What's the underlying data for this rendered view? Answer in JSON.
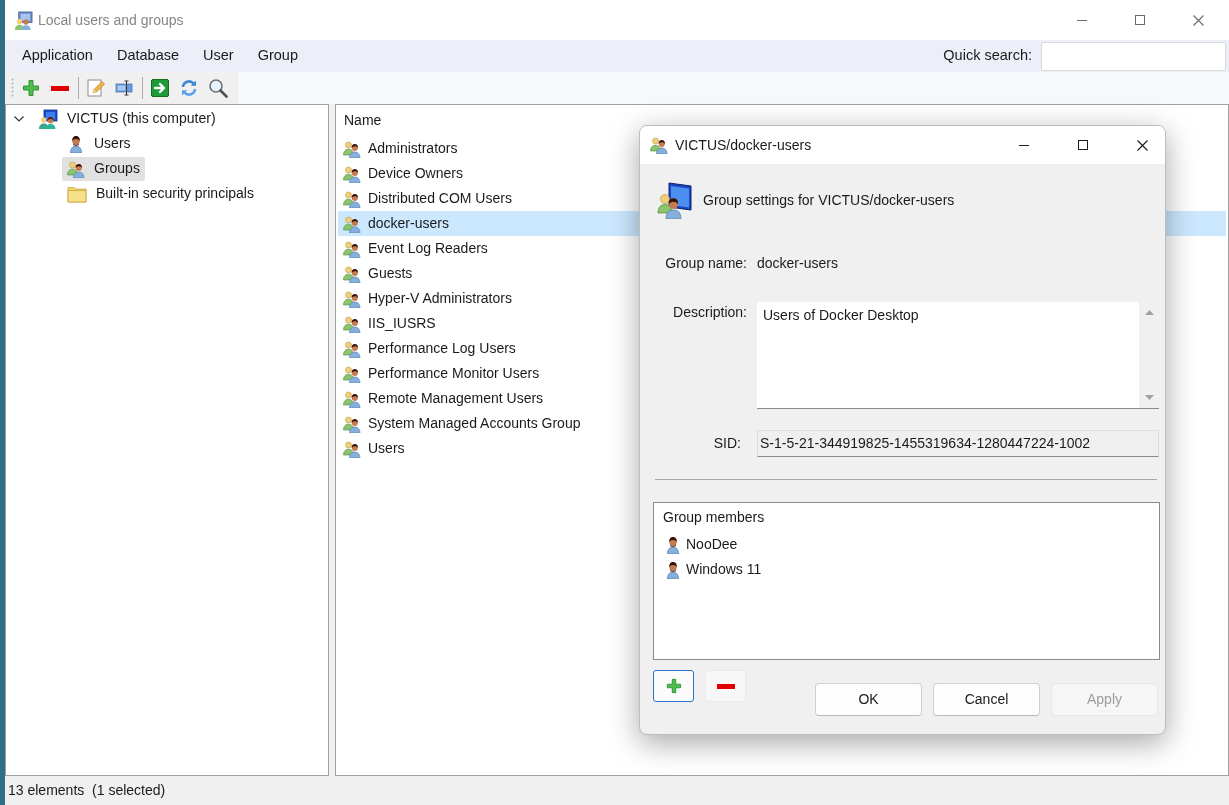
{
  "window": {
    "title": "Local users and groups",
    "active": false
  },
  "menu": [
    "Application",
    "Database",
    "User",
    "Group"
  ],
  "quick_search": {
    "label": "Quick search:"
  },
  "tree": [
    {
      "label": "VICTUS (this computer)",
      "kind": "computer",
      "expanded": true,
      "selected": false,
      "children": [
        {
          "label": "Users",
          "kind": "user",
          "selected": false
        },
        {
          "label": "Groups",
          "kind": "group",
          "selected": true
        },
        {
          "label": "Built-in security principals",
          "kind": "folder",
          "selected": false
        }
      ]
    }
  ],
  "list": {
    "columns": [
      "Name"
    ],
    "rows": [
      {
        "name": "Administrators",
        "selected": false
      },
      {
        "name": "Device Owners",
        "selected": false
      },
      {
        "name": "Distributed COM Users",
        "selected": false
      },
      {
        "name": "docker-users",
        "selected": true
      },
      {
        "name": "Event Log Readers",
        "selected": false
      },
      {
        "name": "Guests",
        "selected": false
      },
      {
        "name": "Hyper-V Administrators",
        "selected": false
      },
      {
        "name": "IIS_IUSRS",
        "selected": false
      },
      {
        "name": "Performance Log Users",
        "selected": false
      },
      {
        "name": "Performance Monitor Users",
        "selected": false
      },
      {
        "name": "Remote Management Users",
        "selected": false
      },
      {
        "name": "System Managed Accounts Group",
        "selected": false
      },
      {
        "name": "Users",
        "selected": false
      }
    ]
  },
  "status_bar": "13 elements  (1 selected)",
  "dialog": {
    "title": "VICTUS/docker-users",
    "active": true,
    "heading": "Group settings for VICTUS/docker-users",
    "group_name": {
      "label": "Group name:",
      "value": "docker-users"
    },
    "description": {
      "label": "Description:",
      "value": "Users of Docker Desktop"
    },
    "sid": {
      "label": "SID:",
      "value": "S-1-5-21-344919825-1455319634-1280447224-1002"
    },
    "members": {
      "header": "Group members",
      "items": [
        {
          "name": "NooDee"
        },
        {
          "name": "Windows 11"
        }
      ]
    },
    "member_buttons": [
      {
        "kind": "add",
        "focused": true
      },
      {
        "kind": "remove",
        "focused": false
      }
    ],
    "buttons": [
      {
        "label": "OK",
        "disabled": false
      },
      {
        "label": "Cancel",
        "disabled": false
      },
      {
        "label": "Apply",
        "disabled": true
      }
    ]
  }
}
